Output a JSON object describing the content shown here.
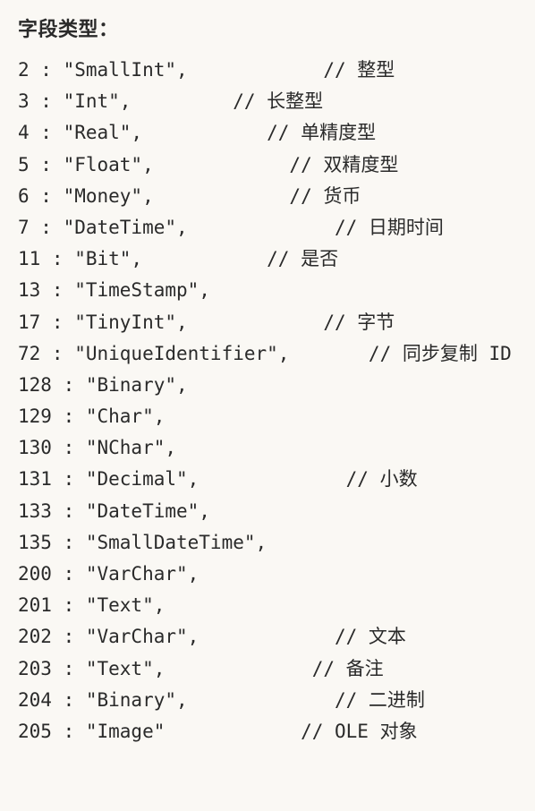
{
  "title": "字段类型：",
  "rows": [
    {
      "key": "2",
      "name": "SmallInt",
      "pad": 12,
      "comment": "整型"
    },
    {
      "key": "3",
      "name": "Int",
      "pad": 9,
      "comment": "长整型"
    },
    {
      "key": "4",
      "name": "Real",
      "pad": 11,
      "comment": "单精度型"
    },
    {
      "key": "5",
      "name": "Float",
      "pad": 12,
      "comment": "双精度型"
    },
    {
      "key": "6",
      "name": "Money",
      "pad": 12,
      "comment": "货币"
    },
    {
      "key": "7",
      "name": "DateTime",
      "pad": 13,
      "comment": "日期时间"
    },
    {
      "key": "11",
      "name": "Bit",
      "pad": 11,
      "comment": "是否"
    },
    {
      "key": "13",
      "name": "TimeStamp",
      "pad": 0,
      "comment": ""
    },
    {
      "key": "17",
      "name": "TinyInt",
      "pad": 12,
      "comment": "字节"
    },
    {
      "key": "72",
      "name": "UniqueIdentifier",
      "pad": 7,
      "comment": "同步复制 ID"
    },
    {
      "key": "128",
      "name": "Binary",
      "pad": 0,
      "comment": ""
    },
    {
      "key": "129",
      "name": "Char",
      "pad": 0,
      "comment": ""
    },
    {
      "key": "130",
      "name": "NChar",
      "pad": 0,
      "comment": ""
    },
    {
      "key": "131",
      "name": "Decimal",
      "pad": 13,
      "comment": "小数"
    },
    {
      "key": "133",
      "name": "DateTime",
      "pad": 0,
      "comment": ""
    },
    {
      "key": "135",
      "name": "SmallDateTime",
      "pad": 0,
      "comment": ""
    },
    {
      "key": "200",
      "name": "VarChar",
      "pad": 0,
      "comment": ""
    },
    {
      "key": "201",
      "name": "Text",
      "pad": 0,
      "comment": ""
    },
    {
      "key": "202",
      "name": "VarChar",
      "pad": 12,
      "comment": "文本"
    },
    {
      "key": "203",
      "name": "Text",
      "pad": 13,
      "comment": "备注"
    },
    {
      "key": "204",
      "name": "Binary",
      "pad": 13,
      "comment": "二进制"
    },
    {
      "key": "205",
      "name": "Image",
      "pad": 12,
      "comment": "OLE 对象",
      "last": true
    }
  ]
}
